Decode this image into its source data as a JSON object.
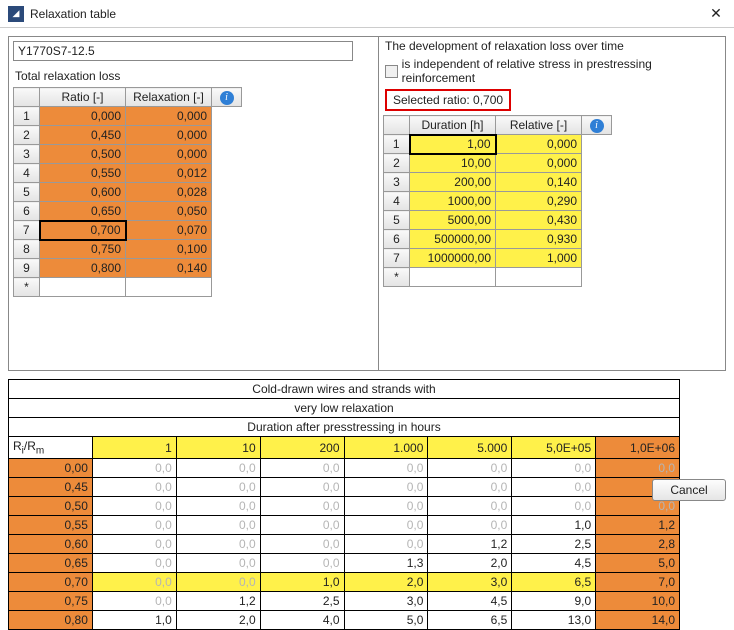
{
  "window": {
    "title": "Relaxation table",
    "close": "✕"
  },
  "left": {
    "identifier": "Y1770S7-12.5",
    "total_label": "Total relaxation loss",
    "cols": {
      "ratio": "Ratio [-]",
      "relax": "Relaxation [-]"
    },
    "rows": [
      {
        "n": "1",
        "ratio": "0,000",
        "relax": "0,000"
      },
      {
        "n": "2",
        "ratio": "0,450",
        "relax": "0,000"
      },
      {
        "n": "3",
        "ratio": "0,500",
        "relax": "0,000"
      },
      {
        "n": "4",
        "ratio": "0,550",
        "relax": "0,012"
      },
      {
        "n": "5",
        "ratio": "0,600",
        "relax": "0,028"
      },
      {
        "n": "6",
        "ratio": "0,650",
        "relax": "0,050"
      },
      {
        "n": "7",
        "ratio": "0,700",
        "relax": "0,070"
      },
      {
        "n": "8",
        "ratio": "0,750",
        "relax": "0,100"
      },
      {
        "n": "9",
        "ratio": "0,800",
        "relax": "0,140"
      }
    ]
  },
  "right": {
    "dev_label": "The development of relaxation loss over time",
    "indep_label": "is independent of relative stress in prestressing reinforcement",
    "selected_ratio": "Selected ratio:  0,700",
    "cols": {
      "dur": "Duration [h]",
      "rel": "Relative [-]"
    },
    "rows": [
      {
        "n": "1",
        "dur": "1,00",
        "rel": "0,000"
      },
      {
        "n": "2",
        "dur": "10,00",
        "rel": "0,000"
      },
      {
        "n": "3",
        "dur": "200,00",
        "rel": "0,140"
      },
      {
        "n": "4",
        "dur": "1000,00",
        "rel": "0,290"
      },
      {
        "n": "5",
        "dur": "5000,00",
        "rel": "0,430"
      },
      {
        "n": "6",
        "dur": "500000,00",
        "rel": "0,930"
      },
      {
        "n": "7",
        "dur": "1000000,00",
        "rel": "1,000"
      }
    ]
  },
  "big": {
    "title1": "Cold-drawn wires and strands  with",
    "title2": "very low  relaxation",
    "title3": "Duration after presstressing in hours",
    "rowlabel": "Ri/Rm",
    "cols": [
      "1",
      "10",
      "200",
      "1.000",
      "5.000",
      "5,0E+05",
      "1,0E+06"
    ],
    "rows": [
      {
        "r": "0,00",
        "v": [
          "0,0",
          "0,0",
          "0,0",
          "0,0",
          "0,0",
          "0,0",
          "0,0"
        ],
        "grey": [
          0,
          1,
          2,
          3,
          4,
          5,
          6
        ]
      },
      {
        "r": "0,45",
        "v": [
          "0,0",
          "0,0",
          "0,0",
          "0,0",
          "0,0",
          "0,0",
          "0,0"
        ],
        "grey": [
          0,
          1,
          2,
          3,
          4,
          5,
          6
        ]
      },
      {
        "r": "0,50",
        "v": [
          "0,0",
          "0,0",
          "0,0",
          "0,0",
          "0,0",
          "0,0",
          "0,0"
        ],
        "grey": [
          0,
          1,
          2,
          3,
          4,
          5,
          6
        ]
      },
      {
        "r": "0,55",
        "v": [
          "0,0",
          "0,0",
          "0,0",
          "0,0",
          "0,0",
          "1,0",
          "1,2"
        ],
        "grey": [
          0,
          1,
          2,
          3,
          4
        ]
      },
      {
        "r": "0,60",
        "v": [
          "0,0",
          "0,0",
          "0,0",
          "0,0",
          "1,2",
          "2,5",
          "2,8"
        ],
        "grey": [
          0,
          1,
          2,
          3
        ]
      },
      {
        "r": "0,65",
        "v": [
          "0,0",
          "0,0",
          "0,0",
          "1,3",
          "2,0",
          "4,5",
          "5,0"
        ],
        "grey": [
          0,
          1,
          2
        ]
      },
      {
        "r": "0,70",
        "v": [
          "0,0",
          "0,0",
          "1,0",
          "2,0",
          "3,0",
          "6,5",
          "7,0"
        ],
        "grey": [
          0,
          1
        ]
      },
      {
        "r": "0,75",
        "v": [
          "0,0",
          "1,2",
          "2,5",
          "3,0",
          "4,5",
          "9,0",
          "10,0"
        ],
        "grey": [
          0
        ]
      },
      {
        "r": "0,80",
        "v": [
          "1,0",
          "2,0",
          "4,0",
          "5,0",
          "6,5",
          "13,0",
          "14,0"
        ],
        "grey": []
      }
    ]
  },
  "buttons": {
    "cancel": "Cancel"
  },
  "chart_data": {
    "type": "table",
    "title": "Cold-drawn wires and strands with very low relaxation — Duration after prestressing in hours",
    "x": [
      1,
      10,
      200,
      1000,
      5000,
      500000,
      1000000
    ],
    "xlabel": "Duration after prestressing [h]",
    "ylabel": "Ri/Rm",
    "series": [
      {
        "name": "0,00",
        "values": [
          0.0,
          0.0,
          0.0,
          0.0,
          0.0,
          0.0,
          0.0
        ]
      },
      {
        "name": "0,45",
        "values": [
          0.0,
          0.0,
          0.0,
          0.0,
          0.0,
          0.0,
          0.0
        ]
      },
      {
        "name": "0,50",
        "values": [
          0.0,
          0.0,
          0.0,
          0.0,
          0.0,
          0.0,
          0.0
        ]
      },
      {
        "name": "0,55",
        "values": [
          0.0,
          0.0,
          0.0,
          0.0,
          0.0,
          1.0,
          1.2
        ]
      },
      {
        "name": "0,60",
        "values": [
          0.0,
          0.0,
          0.0,
          0.0,
          1.2,
          2.5,
          2.8
        ]
      },
      {
        "name": "0,65",
        "values": [
          0.0,
          0.0,
          0.0,
          1.3,
          2.0,
          4.5,
          5.0
        ]
      },
      {
        "name": "0,70",
        "values": [
          0.0,
          0.0,
          1.0,
          2.0,
          3.0,
          6.5,
          7.0
        ]
      },
      {
        "name": "0,75",
        "values": [
          0.0,
          1.2,
          2.5,
          3.0,
          4.5,
          9.0,
          10.0
        ]
      },
      {
        "name": "0,80",
        "values": [
          1.0,
          2.0,
          4.0,
          5.0,
          6.5,
          13.0,
          14.0
        ]
      }
    ]
  }
}
